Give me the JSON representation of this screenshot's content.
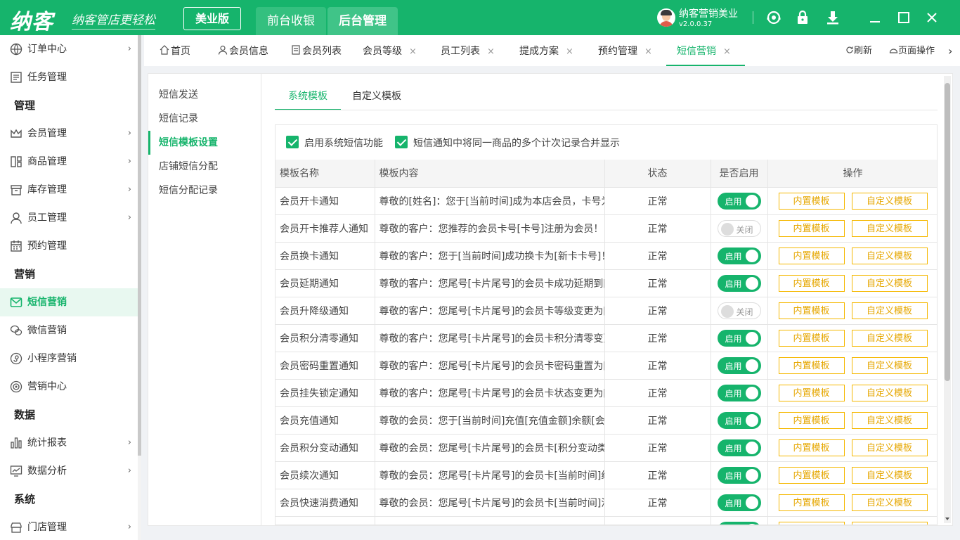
{
  "app": {
    "logo": "纳客",
    "slogan": "纳客管店更轻松",
    "edition": "美业版",
    "nav_front": "前台收银",
    "nav_back": "后台管理",
    "user_name": "纳客营销美业",
    "user_version": "v2.0.0.37"
  },
  "colors": {
    "primary": "#16b46c",
    "warn": "#f5b800"
  },
  "sidebar": [
    {
      "label": "订单中心",
      "icon": "order-icon",
      "chev": "›"
    },
    {
      "label": "任务管理",
      "icon": "task-icon"
    },
    {
      "group": "管理"
    },
    {
      "label": "会员管理",
      "icon": "crown-icon",
      "chev": "›"
    },
    {
      "label": "商品管理",
      "icon": "goods-icon",
      "chev": "›"
    },
    {
      "label": "库存管理",
      "icon": "stock-icon",
      "chev": "›"
    },
    {
      "label": "员工管理",
      "icon": "staff-icon",
      "chev": "›"
    },
    {
      "label": "预约管理",
      "icon": "calendar-icon"
    },
    {
      "group": "营销"
    },
    {
      "label": "短信营销",
      "icon": "mail-icon",
      "active": true
    },
    {
      "label": "微信营销",
      "icon": "wechat-icon"
    },
    {
      "label": "小程序营销",
      "icon": "miniapp-icon"
    },
    {
      "label": "营销中心",
      "icon": "target-icon"
    },
    {
      "group": "数据"
    },
    {
      "label": "统计报表",
      "icon": "bar-chart-icon",
      "chev": "›"
    },
    {
      "label": "数据分析",
      "icon": "analysis-icon",
      "chev": "›"
    },
    {
      "group": "系统"
    },
    {
      "label": "门店管理",
      "icon": "store-icon",
      "chev": "›"
    }
  ],
  "tabs": {
    "home": "首页",
    "member_info": "会员信息",
    "member_list": "会员列表",
    "member_level": "会员等级",
    "staff_list": "员工列表",
    "commission": "提成方案",
    "booking": "预约管理",
    "sms": "短信营销",
    "close": "×",
    "refresh": "刷新",
    "page_ops": "页面操作",
    "more": "›"
  },
  "subnav": [
    "短信发送",
    "短信记录",
    "短信模板设置",
    "店铺短信分配",
    "短信分配记录"
  ],
  "content_tabs": {
    "system": "系统模板",
    "custom": "自定义模板"
  },
  "options": {
    "enable_sys": "启用系统短信功能",
    "merge": "短信通知中将同一商品的多个计次记录合并显示"
  },
  "table": {
    "headers": {
      "name": "模板名称",
      "content": "模板内容",
      "status": "状态",
      "enabled": "是否启用",
      "ops": "操作"
    },
    "on_label": "启用",
    "off_label": "关闭",
    "btn_builtin": "内置模板",
    "btn_custom": "自定义模板",
    "rows": [
      {
        "name": "会员开卡通知",
        "content": "尊敬的[姓名]：您于[当前时间]成为本店会员，卡号为[卡号]",
        "status": "正常",
        "enabled": true
      },
      {
        "name": "会员开卡推荐人通知",
        "content": "尊敬的客户：您推荐的会员卡号[卡号]注册为会员！",
        "status": "正常",
        "enabled": false
      },
      {
        "name": "会员换卡通知",
        "content": "尊敬的客户：您于[当前时间]成功换卡为[新卡卡号]！",
        "status": "正常",
        "enabled": true
      },
      {
        "name": "会员延期通知",
        "content": "尊敬的客户：您尾号[卡片尾号]的会员卡成功延期到[",
        "status": "正常",
        "enabled": true
      },
      {
        "name": "会员升降级通知",
        "content": "尊敬的客户：您尾号[卡片尾号]的会员卡等级变更为[",
        "status": "正常",
        "enabled": false
      },
      {
        "name": "会员积分清零通知",
        "content": "尊敬的客户：您尾号[卡片尾号]的会员卡积分清零变更",
        "status": "正常",
        "enabled": true
      },
      {
        "name": "会员密码重置通知",
        "content": "尊敬的客户：您尾号[卡片尾号]的会员卡密码重置为[",
        "status": "正常",
        "enabled": true
      },
      {
        "name": "会员挂失锁定通知",
        "content": "尊敬的客户：您尾号[卡片尾号]的会员卡状态变更为[",
        "status": "正常",
        "enabled": true
      },
      {
        "name": "会员充值通知",
        "content": "尊敬的会员：您于[当前时间]充值[充值金额]余额[会员",
        "status": "正常",
        "enabled": true
      },
      {
        "name": "会员积分变动通知",
        "content": "尊敬的会员：您尾号[卡片尾号]的会员卡[积分变动类",
        "status": "正常",
        "enabled": true
      },
      {
        "name": "会员续次通知",
        "content": "尊敬的会员：您尾号[卡片尾号]的会员卡[当前时间]续",
        "status": "正常",
        "enabled": true
      },
      {
        "name": "会员快速消费通知",
        "content": "尊敬的会员：您尾号[卡片尾号]的会员卡[当前时间]消",
        "status": "正常",
        "enabled": true
      },
      {
        "name": "",
        "content": "",
        "status": "",
        "enabled": true
      }
    ]
  }
}
